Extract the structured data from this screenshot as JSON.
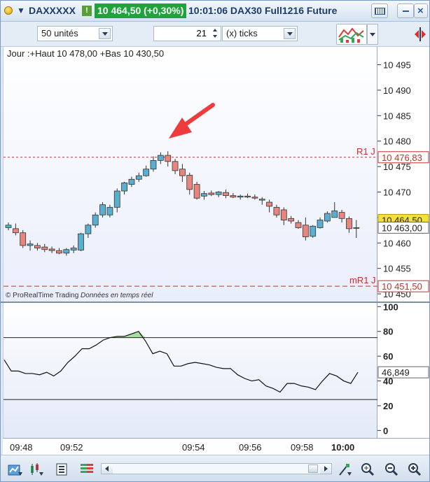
{
  "titlebar": {
    "instrument": "DAXXXXX",
    "flag": "!",
    "price_change": "10 464,50 (+0,30%)",
    "description": "10:01:06 DAX30 Full1216 Future"
  },
  "toolbar": {
    "units": "50 unités",
    "count": "21",
    "ticks": "(x) ticks"
  },
  "chart": {
    "info_line": "Jour :+Haut 10 478,00 +Bas 10 430,50",
    "copyright": "© ProRealTime Trading",
    "realtime": "Données en temps réel",
    "r1_label": "R1 J",
    "r1_value": "10 476,83",
    "mr1_label": "mR1 J",
    "mr1_value": "10 451,50",
    "last_price": "10 464,50",
    "cursor_price": "10 463,00",
    "price_ticks": [
      "10 495",
      "10 490",
      "10 485",
      "10 480",
      "10 475",
      "10 470",
      "10 465",
      "10 460",
      "10 455",
      "10 450"
    ],
    "indicator_value": "46,849",
    "indicator_ticks": [
      "100",
      "80",
      "60",
      "40",
      "20",
      "0"
    ],
    "time_labels": [
      "09:48",
      "09:52",
      "09:54",
      "09:56",
      "09:58",
      "10:00"
    ]
  },
  "colors": {
    "bull": "#5aaecf",
    "bear": "#e7867f",
    "r1": "#d02c2c",
    "last_price_bg": "#f6e03a",
    "arrow": "#ee3b3b",
    "overbought_fill": "#a9dca2"
  },
  "chart_data": {
    "type": "candlestick",
    "ohlc": [
      [
        10463.0,
        10464.0,
        10462.5,
        10463.5
      ],
      [
        10462.8,
        10463.8,
        10461.5,
        10462.0
      ],
      [
        10462.0,
        10462.5,
        10459.0,
        10459.5
      ],
      [
        10459.5,
        10460.5,
        10458.5,
        10459.8
      ],
      [
        10459.5,
        10460.0,
        10458.5,
        10459.0
      ],
      [
        10459.2,
        10459.8,
        10458.2,
        10458.7
      ],
      [
        10458.8,
        10459.3,
        10458.0,
        10458.5
      ],
      [
        10458.5,
        10459.0,
        10457.8,
        10458.0
      ],
      [
        10458.0,
        10459.0,
        10457.5,
        10458.7
      ],
      [
        10458.6,
        10459.5,
        10458.0,
        10459.0
      ],
      [
        10458.6,
        10462.0,
        10458.4,
        10461.8
      ],
      [
        10461.8,
        10463.8,
        10461.0,
        10463.5
      ],
      [
        10463.5,
        10466.0,
        10463.0,
        10465.5
      ],
      [
        10465.5,
        10468.0,
        10465.0,
        10467.5
      ],
      [
        10465.5,
        10467.5,
        10465.0,
        10467.0
      ],
      [
        10467.0,
        10470.7,
        10466.0,
        10470.2
      ],
      [
        10470.2,
        10472.0,
        10469.5,
        10471.8
      ],
      [
        10471.5,
        10473.0,
        10471.0,
        10472.5
      ],
      [
        10472.5,
        10473.8,
        10472.0,
        10473.2
      ],
      [
        10473.2,
        10475.2,
        10473.0,
        10474.5
      ],
      [
        10474.5,
        10477.0,
        10474.0,
        10476.2
      ],
      [
        10476.2,
        10477.8,
        10475.5,
        10477.2
      ],
      [
        10477.2,
        10478.0,
        10475.0,
        10476.0
      ],
      [
        10476.0,
        10476.5,
        10473.5,
        10474.2
      ],
      [
        10474.5,
        10475.5,
        10472.0,
        10473.2
      ],
      [
        10473.3,
        10473.8,
        10469.5,
        10470.5
      ],
      [
        10471.5,
        10472.0,
        10468.5,
        10468.8
      ],
      [
        10469.2,
        10470.2,
        10468.5,
        10469.7
      ],
      [
        10469.8,
        10470.3,
        10469.2,
        10469.5
      ],
      [
        10469.5,
        10470.2,
        10469.0,
        10470.0
      ],
      [
        10469.9,
        10470.5,
        10468.8,
        10469.3
      ],
      [
        10469.3,
        10469.8,
        10468.8,
        10469.0
      ],
      [
        10469.0,
        10469.5,
        10468.5,
        10469.2
      ],
      [
        10469.2,
        10469.7,
        10468.8,
        10469.0
      ],
      [
        10469.0,
        10469.5,
        10468.5,
        10468.8
      ],
      [
        10468.6,
        10469.0,
        10467.5,
        10468.4
      ],
      [
        10468.0,
        10468.5,
        10466.0,
        10467.2
      ],
      [
        10467.0,
        10467.5,
        10465.0,
        10465.5
      ],
      [
        10466.5,
        10467.0,
        10463.5,
        10464.5
      ],
      [
        10464.8,
        10465.3,
        10463.8,
        10464.3
      ],
      [
        10464.0,
        10464.5,
        10462.8,
        10463.0
      ],
      [
        10463.5,
        10465.0,
        10460.5,
        10461.2
      ],
      [
        10461.3,
        10463.5,
        10461.0,
        10463.3
      ],
      [
        10463.0,
        10465.0,
        10462.8,
        10464.5
      ],
      [
        10464.3,
        10466.2,
        10464.0,
        10465.8
      ],
      [
        10465.0,
        10468.0,
        10465.0,
        10466.3
      ],
      [
        10466.0,
        10466.5,
        10464.0,
        10464.8
      ],
      [
        10464.8,
        10465.2,
        10462.0,
        10462.8
      ],
      [
        10463.0,
        10464.5,
        10461.0,
        10463.0
      ]
    ],
    "ylim": [
      10448.5,
      10498.5
    ],
    "r1_level": 10476.83,
    "mr1_level": 10451.5,
    "indicator": {
      "values": [
        57,
        48,
        48,
        46,
        46,
        45,
        47,
        44,
        48,
        55,
        60,
        66,
        66,
        69,
        73,
        75,
        76,
        76,
        78,
        80,
        72,
        62,
        64,
        62,
        52,
        52,
        54,
        55,
        54,
        53,
        51,
        50,
        50,
        45,
        42,
        40,
        41,
        36,
        34,
        31,
        38,
        38,
        36,
        35,
        33,
        40,
        46,
        44,
        40,
        38,
        47
      ],
      "upper_level": 75,
      "lower_level": 25,
      "ylim": [
        -6,
        103
      ]
    }
  }
}
